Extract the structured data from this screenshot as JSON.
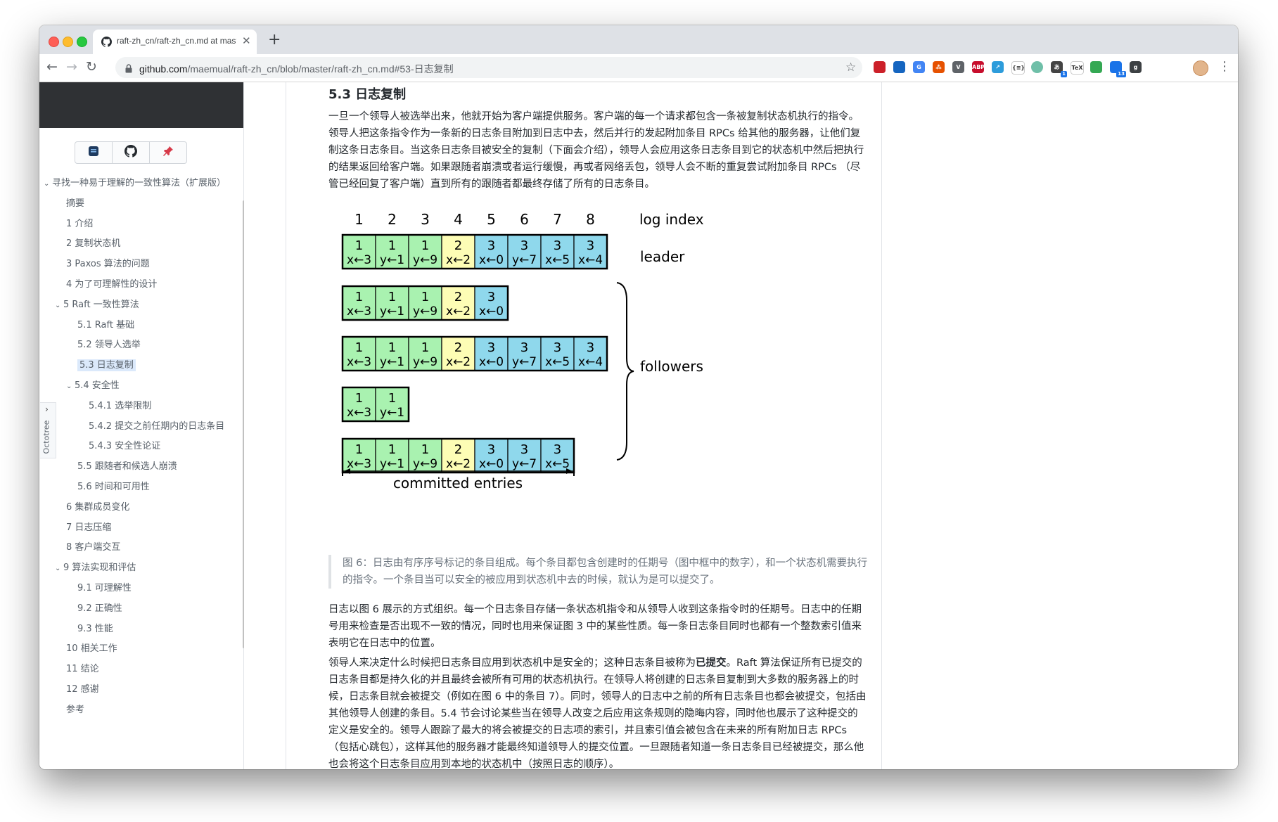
{
  "browser": {
    "tab_title": "raft-zh_cn/raft-zh_cn.md at master",
    "url_domain": "github.com",
    "url_path": "/maemual/raft-zh_cn/blob/master/raft-zh_cn.md#53-日志复制",
    "extensions": [
      {
        "name": "lastpass-icon",
        "color": "#cc2029",
        "text": ""
      },
      {
        "name": "graduation-cap-icon",
        "color": "#1565c0",
        "text": ""
      },
      {
        "name": "google-translate-icon",
        "color": "#4285f4",
        "text": "G"
      },
      {
        "name": "share-icon",
        "color": "#e65100",
        "text": "⁂"
      },
      {
        "name": "vue-devtools-icon",
        "color": "#5f6368",
        "text": "V"
      },
      {
        "name": "adblock-plus-icon",
        "color": "#c70d2c",
        "text": "ABP"
      },
      {
        "name": "direct-link-icon",
        "color": "#2d9cdb",
        "text": "↗"
      },
      {
        "name": "json-formatter-icon",
        "color": "#ffffff",
        "text": "{≡}"
      },
      {
        "name": "green-circle-icon",
        "color": "#6fbfa8",
        "text": ""
      },
      {
        "name": "translate-badge-icon",
        "color": "#444444",
        "text": "あ",
        "badge": "1"
      },
      {
        "name": "tex-icon",
        "color": "#ffffff",
        "text": "TeX"
      },
      {
        "name": "chrome-grid-icon",
        "color": "#34a853",
        "text": ""
      },
      {
        "name": "grid-apps-icon",
        "color": "#1a73e8",
        "text": "",
        "badge": "13"
      },
      {
        "name": "g-icon",
        "color": "#3c4043",
        "text": "g"
      }
    ]
  },
  "sidebar": {
    "octotree_label": "Octotree",
    "items": [
      {
        "label": "寻找一种易于理解的一致性算法（扩展版）",
        "level": 0,
        "caret": "⌄",
        "active": false
      },
      {
        "label": "摘要",
        "level": 1,
        "caret": "",
        "active": false
      },
      {
        "label": "1 介绍",
        "level": 1,
        "caret": "",
        "active": false
      },
      {
        "label": "2 复制状态机",
        "level": 1,
        "caret": "",
        "active": false
      },
      {
        "label": "3 Paxos 算法的问题",
        "level": 1,
        "caret": "",
        "active": false
      },
      {
        "label": "4 为了可理解性的设计",
        "level": 1,
        "caret": "",
        "active": false
      },
      {
        "label": "5 Raft 一致性算法",
        "level": 1,
        "caret": "⌄",
        "active": false
      },
      {
        "label": "5.1 Raft 基础",
        "level": 2,
        "caret": "",
        "active": false
      },
      {
        "label": "5.2 领导人选举",
        "level": 2,
        "caret": "",
        "active": false
      },
      {
        "label": "5.3 日志复制",
        "level": 2,
        "caret": "",
        "active": true
      },
      {
        "label": "5.4 安全性",
        "level": 2,
        "caret": "⌄",
        "active": false
      },
      {
        "label": "5.4.1 选举限制",
        "level": 3,
        "caret": "",
        "active": false
      },
      {
        "label": "5.4.2 提交之前任期内的日志条目",
        "level": 3,
        "caret": "",
        "active": false
      },
      {
        "label": "5.4.3 安全性论证",
        "level": 3,
        "caret": "",
        "active": false
      },
      {
        "label": "5.5 跟随者和候选人崩溃",
        "level": 2,
        "caret": "",
        "active": false
      },
      {
        "label": "5.6 时间和可用性",
        "level": 2,
        "caret": "",
        "active": false
      },
      {
        "label": "6 集群成员变化",
        "level": 1,
        "caret": "",
        "active": false
      },
      {
        "label": "7 日志压缩",
        "level": 1,
        "caret": "",
        "active": false
      },
      {
        "label": "8 客户端交互",
        "level": 1,
        "caret": "",
        "active": false
      },
      {
        "label": "9 算法实现和评估",
        "level": 1,
        "caret": "⌄",
        "active": false
      },
      {
        "label": "9.1 可理解性",
        "level": 2,
        "caret": "",
        "active": false
      },
      {
        "label": "9.2 正确性",
        "level": 2,
        "caret": "",
        "active": false
      },
      {
        "label": "9.3 性能",
        "level": 2,
        "caret": "",
        "active": false
      },
      {
        "label": "10 相关工作",
        "level": 1,
        "caret": "",
        "active": false
      },
      {
        "label": "11 结论",
        "level": 1,
        "caret": "",
        "active": false
      },
      {
        "label": "12 感谢",
        "level": 1,
        "caret": "",
        "active": false
      },
      {
        "label": "参考",
        "level": 1,
        "caret": "",
        "active": false
      }
    ]
  },
  "article": {
    "heading": "5.3 日志复制",
    "para1": "一旦一个领导人被选举出来，他就开始为客户端提供服务。客户端的每一个请求都包含一条被复制状态机执行的指令。领导人把这条指令作为一条新的日志条目附加到日志中去，然后并行的发起附加条目 RPCs 给其他的服务器，让他们复制这条日志条目。当这条日志条目被安全的复制（下面会介绍），领导人会应用这条日志条目到它的状态机中然后把执行的结果返回给客户端。如果跟随者崩溃或者运行缓慢，再或者网络丢包，领导人会不断的重复尝试附加条目 RPCs （尽管已经回复了客户端）直到所有的跟随者都最终存储了所有的日志条目。",
    "caption": "图 6：日志由有序序号标记的条目组成。每个条目都包含创建时的任期号（图中框中的数字），和一个状态机需要执行的指令。一个条目当可以安全的被应用到状态机中去的时候，就认为是可以提交了。",
    "para2": "日志以图 6 展示的方式组织。每一个日志条目存储一条状态机指令和从领导人收到这条指令时的任期号。日志中的任期号用来检查是否出现不一致的情况，同时也用来保证图 3 中的某些性质。每一条日志条目同时也都有一个整数索引值来表明它在日志中的位置。",
    "para3_a": "领导人来决定什么时候把日志条目应用到状态机中是安全的；这种日志条目被称为",
    "para3_bold": "已提交",
    "para3_b": "。Raft 算法保证所有已提交的日志条目都是持久化的并且最终会被所有可用的状态机执行。在领导人将创建的日志条目复制到大多数的服务器上的时候，日志条目就会被提交（例如在图 6 中的条目 7）。同时，领导人的日志中之前的所有日志条目也都会被提交，包括由其他领导人创建的条目。5.4 节会讨论某些当在领导人改变之后应用这条规则的隐晦内容，同时他也展示了这种提交的定义是安全的。领导人跟踪了最大的将会被提交的日志项的索引，并且索引值会被包含在未来的所有附加日志 RPCs （包括心跳包），这样其他的服务器才能最终知道领导人的提交位置。一旦跟随者知道一条日志条目已经被提交，那么他也会将这个日志条目应用到本地的状态机中（按照日志的顺序）。"
  },
  "figure": {
    "index_numbers": [
      "1",
      "2",
      "3",
      "4",
      "5",
      "6",
      "7",
      "8"
    ],
    "log_index_label": "log index",
    "leader_label": "leader",
    "followers_label": "followers",
    "committed_label": "committed entries",
    "term_colors": {
      "1": "#a9f2b0",
      "2": "#fdfdb5",
      "3": "#8fd8ec"
    },
    "entries": [
      {
        "term": "1",
        "cmd": "x←3"
      },
      {
        "term": "1",
        "cmd": "y←1"
      },
      {
        "term": "1",
        "cmd": "y←9"
      },
      {
        "term": "2",
        "cmd": "x←2"
      },
      {
        "term": "3",
        "cmd": "x←0"
      },
      {
        "term": "3",
        "cmd": "y←7"
      },
      {
        "term": "3",
        "cmd": "x←5"
      },
      {
        "term": "3",
        "cmd": "x←4"
      }
    ],
    "log_lengths": [
      8,
      5,
      8,
      2,
      7
    ]
  }
}
